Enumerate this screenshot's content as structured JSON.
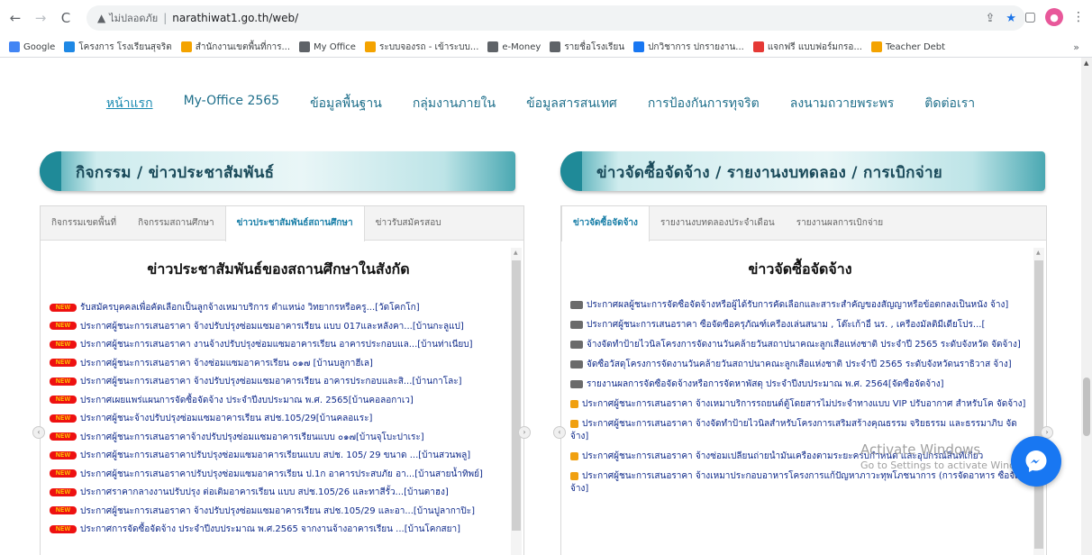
{
  "browser": {
    "insecure_label": "ไม่ปลอดภัย",
    "url": "narathiwat1.go.th/web/",
    "bookmarks": [
      {
        "label": "Google",
        "color": "#4285f4"
      },
      {
        "label": "โครงการ โรงเรียนสุจริต",
        "color": "#1e88e5"
      },
      {
        "label": "สำนักงานเขตพื้นที่การ...",
        "color": "#f4a300"
      },
      {
        "label": "My Office",
        "color": "#5f6368"
      },
      {
        "label": "ระบบจองรถ - เข้าระบบ...",
        "color": "#f4a300"
      },
      {
        "label": "e-Money",
        "color": "#5f6368"
      },
      {
        "label": "รายชื่อโรงเรียน",
        "color": "#5f6368"
      },
      {
        "label": "ปกวิชาการ ปกรายงาน...",
        "color": "#1877f2"
      },
      {
        "label": "แจกฟรี แบบฟอร์มกรอ...",
        "color": "#e53935"
      },
      {
        "label": "Teacher Debt",
        "color": "#f4a300"
      }
    ],
    "more": "»"
  },
  "nav": {
    "items": [
      "หน้าแรก",
      "My-Office 2565",
      "ข้อมูลพื้นฐาน",
      "กลุ่มงานภายใน",
      "ข้อมูลสารสนเทศ",
      "การป้องกันการทุจริต",
      "ลงนามถวายพระพร",
      "ติดต่อเรา"
    ]
  },
  "left_section": {
    "banner": "กิจกรรม / ข่าวประชาสัมพันธ์",
    "tabs": [
      "กิจกรรมเขตพื้นที่",
      "กิจกรรมสถานศึกษา",
      "ข่าวประชาสัมพันธ์สถานศึกษา",
      "ข่าวรับสมัครสอบ"
    ],
    "active_tab": 2,
    "heading": "ข่าวประชาสัมพันธ์ของสถานศึกษาในสังกัด",
    "badge": "NEW",
    "items": [
      "รับสมัครบุคคลเพื่อคัดเลือกเป็นลูกจ้างเหมาบริการ ตำแหน่ง วิทยากรหรือครู...[วัดโคกโก]",
      "ประกาศผู้ชนะการเสนอราคา จ้างปรับปรุงซ่อมแซมอาคารเรียน แบบ 017และหลังคา...[บ้านกะลูแป]",
      "ประกาศผู้ชนะการเสนอราคา งานจ้างปรับปรุงซ่อมแซมอาคารเรียน อาคารประกอบแล...[บ้านท่าเนียบ]",
      "ประกาศผู้ชนะการเสนอราคา จ้างซ่อมแซมอาคารเรียน ๐๑๗ [บ้านบลูกาฮีเล]",
      "ประกาศผู้ชนะการเสนอราคา จ้างปรับปรุงซ่อมแซมอาคารเรียน อาคารประกอบและสิ...[บ้านกาโละ]",
      "ประกาศเผยแพร่แผนการจัดซื้อจัดจ้าง ประจำปีงบประมาณ พ.ศ. 2565[บ้านคอลอกาเว]",
      "ประกาศผู้ชนะจ้างปรับปรุงซ่อมแซมอาคารเรียน สปช.105/29[บ้านคลอแระ]",
      "ประกาศผู้ชนะการเสนอราคาจ้างปรับปรุงซ่อมแซมอาคารเรียนแบบ ๐๑๗[บ้านจุโบะปาเระ]",
      "ประกาศผู้ชนะการเสนอราคาปรับปรุงซ่อมแซมอาคารเรียนแบบ สปช. 105/ 29 ขนาด ...[บ้านสวนพลู]",
      "ประกาศผู้ชนะการเสนอราคาปรับปรุงซ่อมแซมอาคารเรียน ป.1ก อาคารประสบภัย อา...[บ้านสายน้ำทิพย์]",
      "ประกาศราคากลางงานปรับปรุง ต่อเติมอาคารเรียน แบบ สปช.105/26 และทาสีรั้ว...[บ้านตาฮง]",
      "ประกาศผู้ชนะการเสนอราคา จ้างปรับปรุงซ่อมแซมอาคารเรียน สปช.105/29 และอา...[บ้านปูลากาปิะ]",
      "ประกาศการจัดซื้อจัดจ้าง ประจำปีงบประมาณ พ.ศ.2565 จากงานจ้างอาคารเรียน ...[บ้านโคกสยา]"
    ]
  },
  "right_section": {
    "banner": "ข่าวจัดซื้อจัดจ้าง / รายงานงบทดลอง / การเบิกจ่าย",
    "tabs": [
      "ข่าวจัดซื้อจัดจ้าง",
      "รายงานงบทดลองประจำเดือน",
      "รายงานผลการเบิกจ่าย"
    ],
    "active_tab": 0,
    "heading": "ข่าวจัดซื้อจัดจ้าง",
    "items": [
      {
        "badge": "gray",
        "text": "ประกาศผลผู้ชนะการจัดซื้อจัดจ้างหรือผู้ได้รับการคัดเลือกและสาระสำคัญของสัญญาหรือข้อตกลงเป็นหนัง จ้าง]"
      },
      {
        "badge": "gray",
        "text": "ประกาศผู้ชนะการเสนอราคา ซื้อจัดซื้อครุภัณฑ์เครื่องเล่นสนาม , โต๊ะเก้าอี้ นร. , เครื่องมัลติมีเดียโปร...["
      },
      {
        "badge": "gray",
        "text": "จ้างจัดทำป้ายไวนิลโครงการจัดงานวันคล้ายวันสถาปนาคณะลูกเสือแห่งชาติ ประจำปี 2565 ระดับจังหวัด จัดจ้าง]"
      },
      {
        "badge": "gray",
        "text": "จัดซื้อวัสดุโครงการจัดงานวันคล้ายวันสถาปนาคณะลูกเสือแห่งชาติ ประจำปี 2565 ระดับจังหวัดนราธิวาส จ้าง]"
      },
      {
        "badge": "gray",
        "text": "รายงานผลการจัดซื้อจัดจ้างหรือการจัดหาพัสดุ ประจำปีงบประมาณ พ.ศ. 2564[จัดซื้อจัดจ้าง]"
      },
      {
        "badge": "orange",
        "text": "ประกาศผู้ชนะการเสนอราคา จ้างเหมาบริการรถยนต์ตู้โดยสารไม่ประจำทางแบบ VIP ปรับอากาศ สำหรับโค จัดจ้าง]"
      },
      {
        "badge": "orange",
        "text": "ประกาศผู้ชนะการเสนอราคา จ้างจัดทำป้ายไวนิลสำหรับโครงการเสริมสร้างคุณธรรม จริยธรรม และธรรมาภิบ จัดจ้าง]"
      },
      {
        "badge": "orange",
        "text": "ประกาศผู้ชนะการเสนอราคา จ้างซ่อมเปลี่ยนถ่ายน้ำมันเครื่องตามระยะครบกำหนด และอุปกรณ์สิ้นที่เกี่ยว"
      },
      {
        "badge": "orange",
        "text": "ประกาศผู้ชนะการเสนอราคา จ้างเหมาประกอบอาหารโครงการแก้ปัญหาภาวะทุพโภชนาการ (การจัดอาหาร ซื้อจัดจ้าง]"
      }
    ]
  },
  "watermark": {
    "title": "Activate Windows",
    "sub": "Go to Settings to activate Windows."
  }
}
